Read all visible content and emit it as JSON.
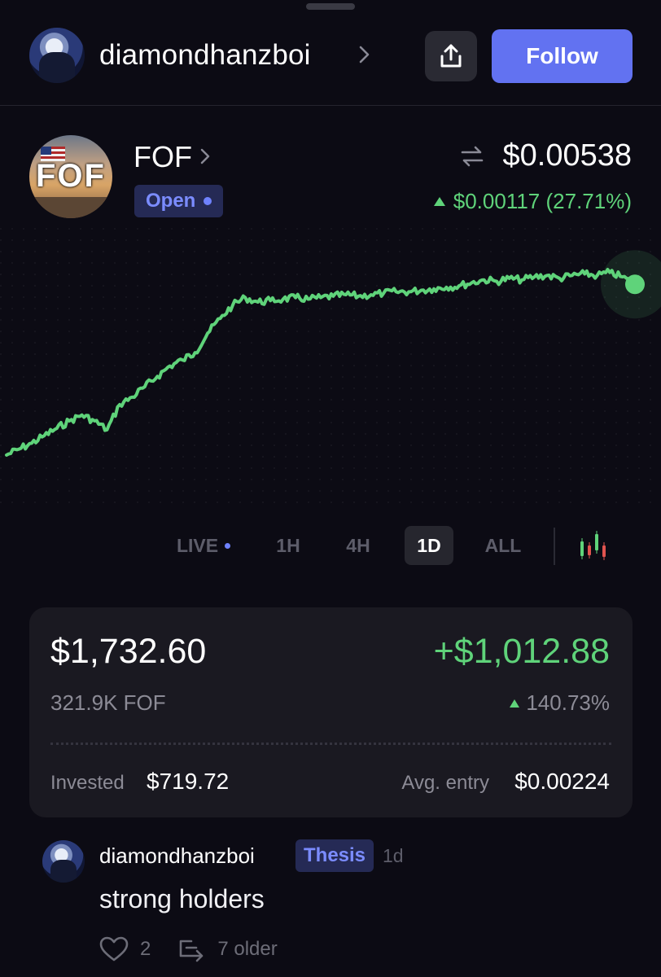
{
  "header": {
    "username": "diamondhanzboi",
    "follow_label": "Follow"
  },
  "token": {
    "name": "FOF",
    "status": "Open",
    "price": "$0.00538",
    "change": "$0.00117 (27.71%)",
    "logo_text": "FOF"
  },
  "chart_data": {
    "type": "line",
    "x": [
      0,
      2,
      4,
      6,
      8,
      10,
      12,
      14,
      16,
      18,
      20,
      22,
      24,
      26,
      28,
      30,
      32,
      34,
      36,
      38,
      40,
      42,
      44,
      46,
      48,
      50,
      52,
      54,
      56,
      58,
      60,
      62,
      64,
      66,
      68,
      70,
      72,
      74,
      76,
      78,
      80,
      82,
      84,
      86,
      88,
      90,
      92,
      94,
      96,
      98,
      100
    ],
    "values": [
      0.00423,
      0.00427,
      0.00431,
      0.00436,
      0.00441,
      0.00446,
      0.0045,
      0.00446,
      0.0044,
      0.00457,
      0.00462,
      0.00469,
      0.00476,
      0.00483,
      0.00487,
      0.00492,
      0.00505,
      0.00515,
      0.00524,
      0.00529,
      0.00526,
      0.00527,
      0.00528,
      0.00529,
      0.00528,
      0.00529,
      0.0053,
      0.00531,
      0.0053,
      0.00531,
      0.00532,
      0.00533,
      0.00533,
      0.00534,
      0.00535,
      0.00536,
      0.00537,
      0.00539,
      0.00541,
      0.0054,
      0.00542,
      0.00541,
      0.00543,
      0.00544,
      0.00542,
      0.00544,
      0.00545,
      0.00544,
      0.00546,
      0.00543,
      0.00538
    ],
    "ylim": [
      0.00395,
      0.00565
    ],
    "series": [
      {
        "values_ref": "values"
      }
    ],
    "grid": true,
    "color": "#5fd37a"
  },
  "timeframes": [
    {
      "label": "LIVE"
    },
    {
      "label": "1H"
    },
    {
      "label": "4H"
    },
    {
      "label": "1D"
    },
    {
      "label": "ALL"
    }
  ],
  "active_timeframe": "1D",
  "position": {
    "value": "$1,732.60",
    "pnl": "+$1,012.88",
    "quantity": "321.9K FOF",
    "pnl_percent": "140.73%",
    "invested_label": "Invested",
    "invested_value": "$719.72",
    "avg_entry_label": "Avg. entry",
    "avg_entry_value": "$0.00224"
  },
  "comment": {
    "username": "diamondhanzboi",
    "tag": "Thesis",
    "time": "1d",
    "text": "strong holders",
    "likes": "2",
    "older": "7 older"
  },
  "colors": {
    "accent": "#6272f1",
    "positive": "#5fd37a",
    "background": "#0c0b14",
    "card": "#1a1921"
  }
}
